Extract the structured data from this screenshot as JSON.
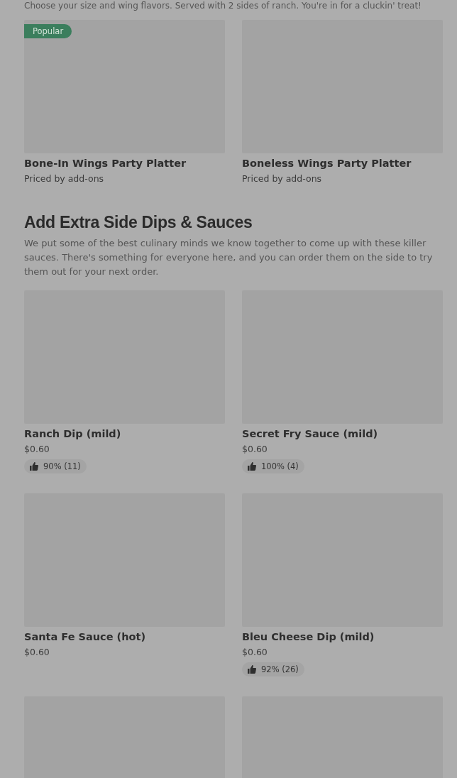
{
  "sections": [
    {
      "description": "Choose your size and wing flavors. Served with 2 sides of ranch. You're in for a cluckin' treat!",
      "items": [
        {
          "kind": "item",
          "badge": "Popular",
          "name": "Bone-In Wings Party Platter",
          "price": "Priced by add-ons"
        },
        {
          "kind": "item",
          "name": "Boneless Wings Party Platter",
          "price": "Priced by add-ons"
        }
      ]
    },
    {
      "title": "Add Extra Side Dips & Sauces",
      "description": "We put some of the best culinary minds we know together to come up with these killer sauces. There's something for everyone here, and you can order them on the side to try them out for your next order.",
      "items": [
        {
          "kind": "item",
          "name": "Ranch Dip (mild)",
          "price": "$0.60",
          "rating": "90% (11)"
        },
        {
          "kind": "item",
          "name": "Secret Fry Sauce (mild)",
          "price": "$0.60",
          "rating": "100% (4)"
        },
        {
          "kind": "item",
          "name": "Santa Fe Sauce (hot)",
          "price": "$0.60"
        },
        {
          "kind": "item",
          "name": "Bleu Cheese Dip (mild)",
          "price": "$0.60",
          "rating": "92% (26)"
        },
        {
          "kind": "image-only"
        },
        {
          "kind": "image-only"
        }
      ]
    }
  ]
}
